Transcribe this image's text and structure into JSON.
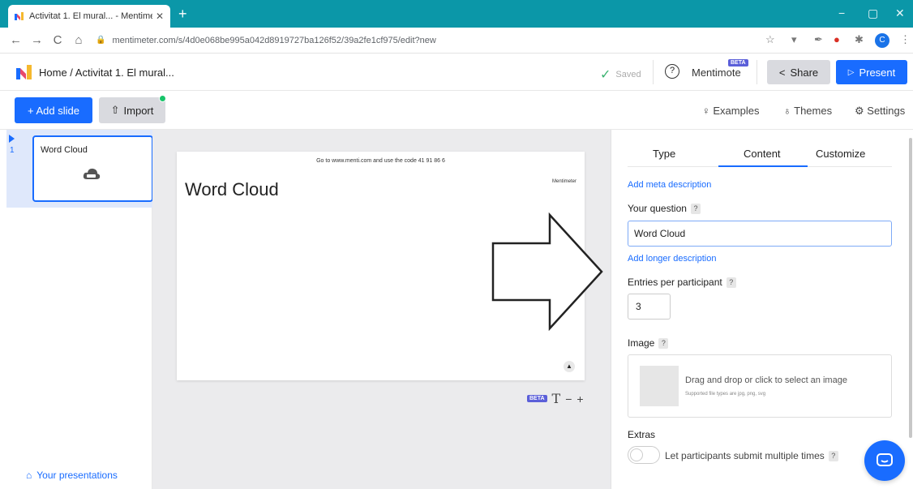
{
  "browser": {
    "tab_title": "Activitat 1. El mural... - Mentime...",
    "tab_close": "✕",
    "new_tab": "+",
    "url": "mentimeter.com/s/4d0e068be995a042d8919727ba126f52/39a2fe1cf975/edit?new",
    "back": "←",
    "forward": "→",
    "reload": "C",
    "home": "⌂",
    "bookmark": "☆",
    "avatar_initial": "C",
    "menu": "⋮",
    "minimize": "−",
    "maximize": "▢",
    "close": "✕"
  },
  "header": {
    "breadcrumb": "Home / Activitat 1. El mural...",
    "saved": "Saved",
    "help": "?",
    "mentimote": "Mentimote",
    "beta": "BETA",
    "share": "Share",
    "present": "Present"
  },
  "toolbar": {
    "add_slide": "+ Add slide",
    "import": "Import",
    "examples": "Examples",
    "themes": "Themes",
    "settings": "Settings"
  },
  "slides": [
    {
      "number": "1",
      "title": "Word Cloud"
    }
  ],
  "sidebar": {
    "your_presentations": "Your presentations"
  },
  "canvas": {
    "code_text": "Go to www.menti.com and use the code 41 91 86 6",
    "brand": "Mentimeter",
    "title": "Word Cloud",
    "beta": "BETA",
    "text_tool": "T",
    "zoom_out": "−",
    "zoom_in": "+"
  },
  "panel": {
    "tabs": [
      "Type",
      "Content",
      "Customize"
    ],
    "active_tab": "Content",
    "add_meta": "Add meta description",
    "your_question_label": "Your question",
    "question_value": "Word Cloud",
    "add_longer": "Add longer description",
    "entries_label": "Entries per participant",
    "entries_value": "3",
    "image_label": "Image",
    "drop_text": "Drag and drop or click to select an image",
    "drop_sub": "Supported file types are jpg, png, svg",
    "extras_label": "Extras",
    "toggle_label": "Let participants submit multiple times",
    "help": "?"
  },
  "colors": {
    "browser_teal": "#0b97a8",
    "brand_blue": "#196cff",
    "beta_purple": "#5b5fd9",
    "saved_green": "#3cb371"
  }
}
